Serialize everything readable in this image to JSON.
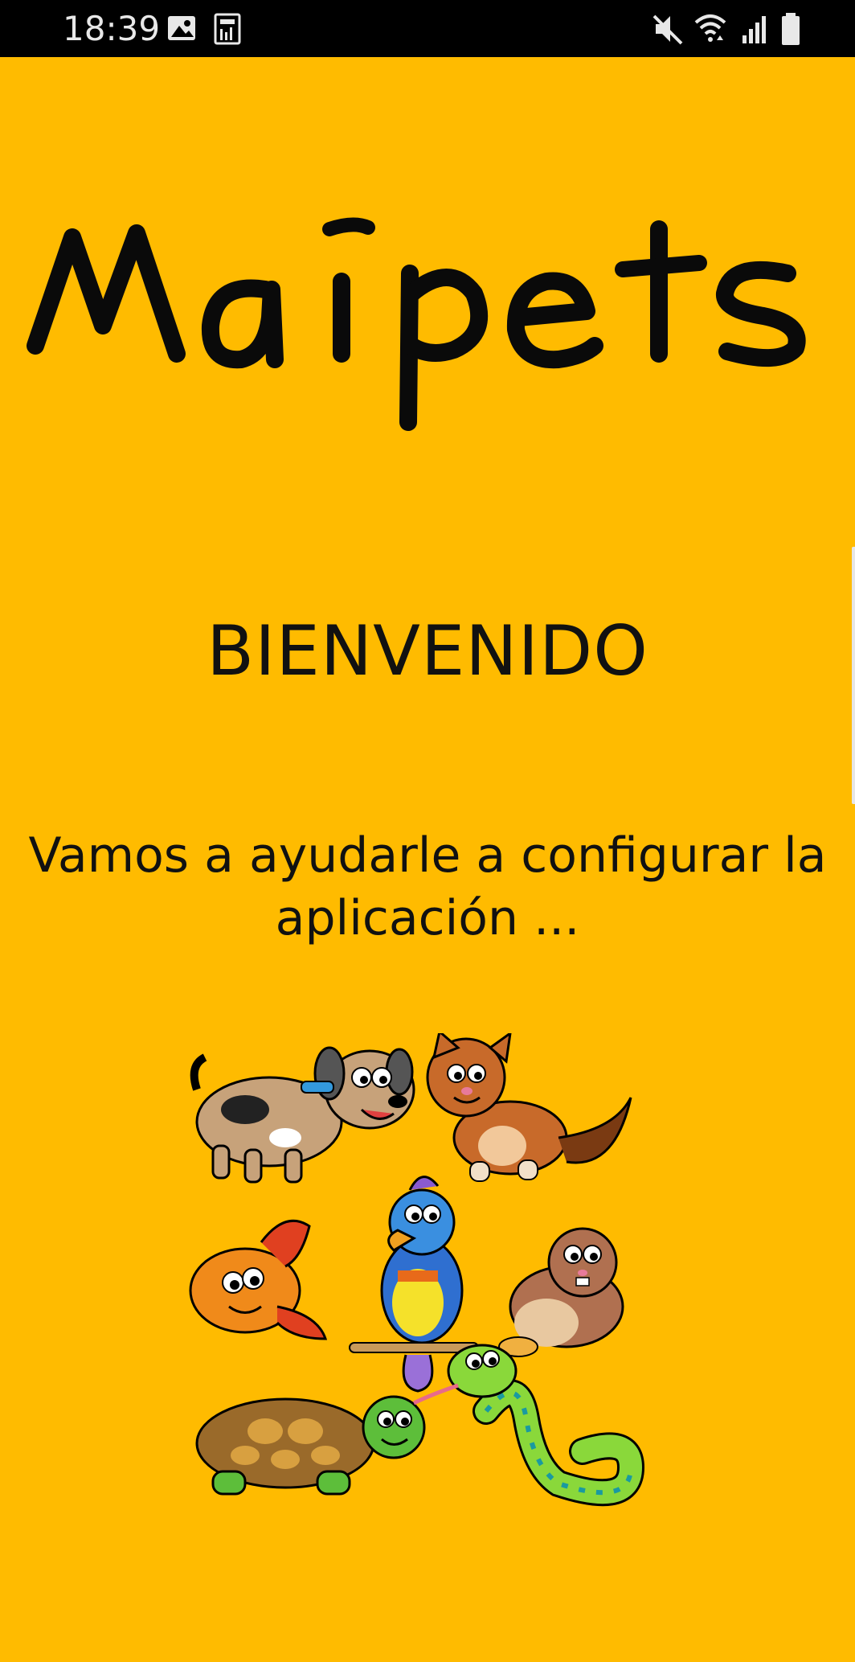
{
  "status_bar": {
    "time": "18:39",
    "icons_left": [
      "image-icon",
      "data-usage-icon"
    ],
    "icons_right": [
      "mute-icon",
      "wifi-icon",
      "cell-signal-icon",
      "battery-icon"
    ]
  },
  "app": {
    "logo_text": "Maipets",
    "welcome_title": "BIENVENIDO",
    "welcome_text": "Vamos a ayudarle a configurar la aplicación ...",
    "illustration": "pets-illustration",
    "animals": [
      "dog",
      "cat",
      "fish",
      "parrot",
      "hamster",
      "turtle",
      "snake"
    ]
  },
  "colors": {
    "background": "#FFBB00",
    "status_bar": "#000000",
    "text": "#111111"
  }
}
